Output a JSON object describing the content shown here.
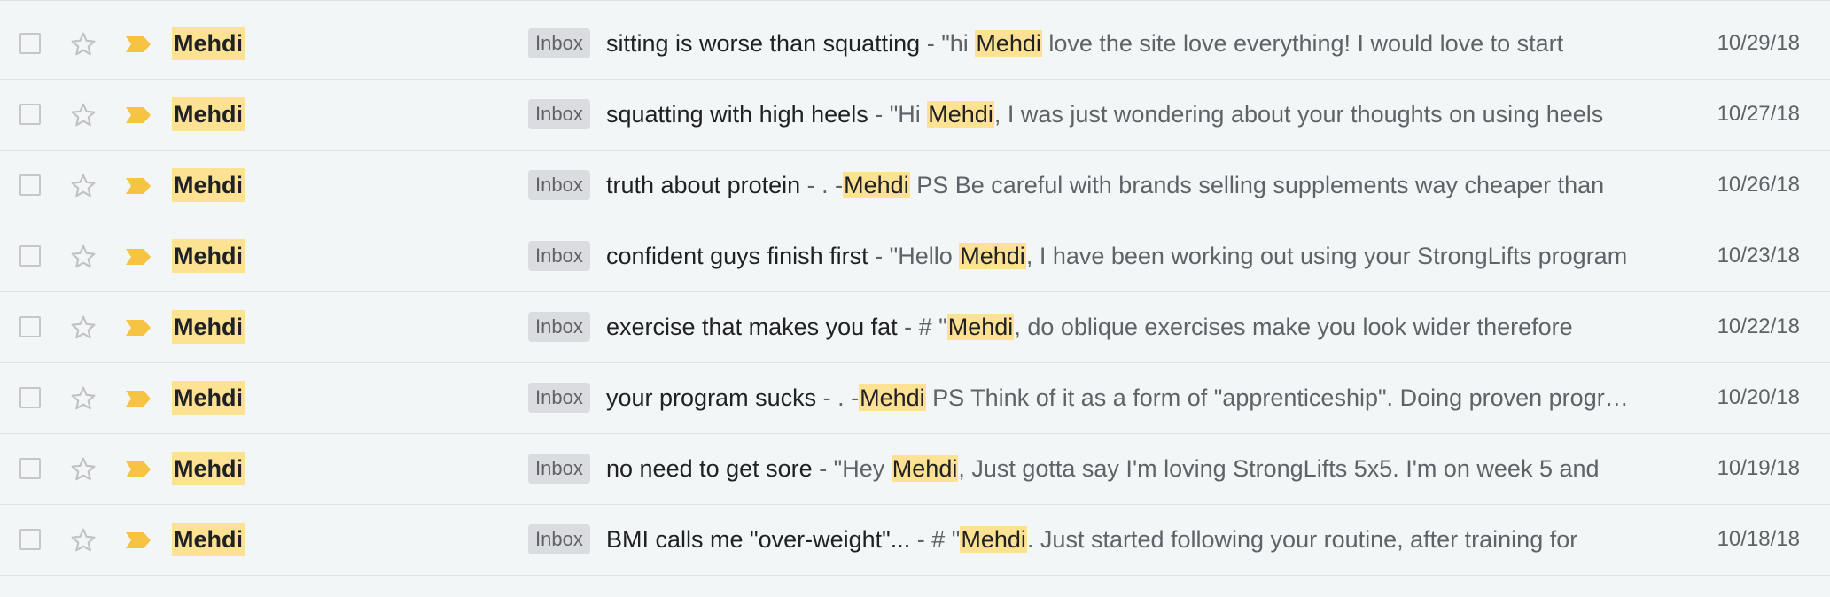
{
  "emails": [
    {
      "sender": "Mehdi",
      "label": "Inbox",
      "subject": "sitting is worse than squatting",
      "snippet_before": " - \"hi ",
      "snippet_hl": "Mehdi",
      "snippet_after": " love the site love everything! I would love to start",
      "date": "10/29/18"
    },
    {
      "sender": "Mehdi",
      "label": "Inbox",
      "subject": "squatting with high heels",
      "snippet_before": " - \"Hi ",
      "snippet_hl": "Mehdi",
      "snippet_after": ", I was just wondering about your thoughts on using heels",
      "date": "10/27/18"
    },
    {
      "sender": "Mehdi",
      "label": "Inbox",
      "subject": "truth about protein",
      "snippet_before": " - . -",
      "snippet_hl": "Mehdi",
      "snippet_after": " PS Be careful with brands selling supplements way cheaper than",
      "date": "10/26/18"
    },
    {
      "sender": "Mehdi",
      "label": "Inbox",
      "subject": "confident guys finish first",
      "snippet_before": " - \"Hello ",
      "snippet_hl": "Mehdi",
      "snippet_after": ", I have been working out using your StrongLifts program",
      "date": "10/23/18"
    },
    {
      "sender": "Mehdi",
      "label": "Inbox",
      "subject": "exercise that makes you fat",
      "snippet_before": " - # \"",
      "snippet_hl": "Mehdi",
      "snippet_after": ", do oblique exercises make you look wider therefore",
      "date": "10/22/18"
    },
    {
      "sender": "Mehdi",
      "label": "Inbox",
      "subject": "your program sucks",
      "snippet_before": " - . -",
      "snippet_hl": "Mehdi",
      "snippet_after": " PS Think of it as a form of \"apprenticeship\". Doing proven programs",
      "date": "10/20/18"
    },
    {
      "sender": "Mehdi",
      "label": "Inbox",
      "subject": "no need to get sore",
      "snippet_before": " - \"Hey ",
      "snippet_hl": "Mehdi",
      "snippet_after": ", Just gotta say I'm loving StrongLifts 5x5. I'm on week 5 and",
      "date": "10/19/18"
    },
    {
      "sender": "Mehdi",
      "label": "Inbox",
      "subject": "BMI calls me \"over-weight\"...",
      "snippet_before": " - # \"",
      "snippet_hl": "Mehdi",
      "snippet_after": ". Just started following your routine, after training for",
      "date": "10/18/18"
    }
  ],
  "icons": {
    "checkbox": "checkbox-icon",
    "star": "star-icon",
    "importance": "importance-marker-icon"
  },
  "colors": {
    "highlight": "#fde293",
    "importance": "#f6c342",
    "chip_bg": "#dadce0"
  }
}
